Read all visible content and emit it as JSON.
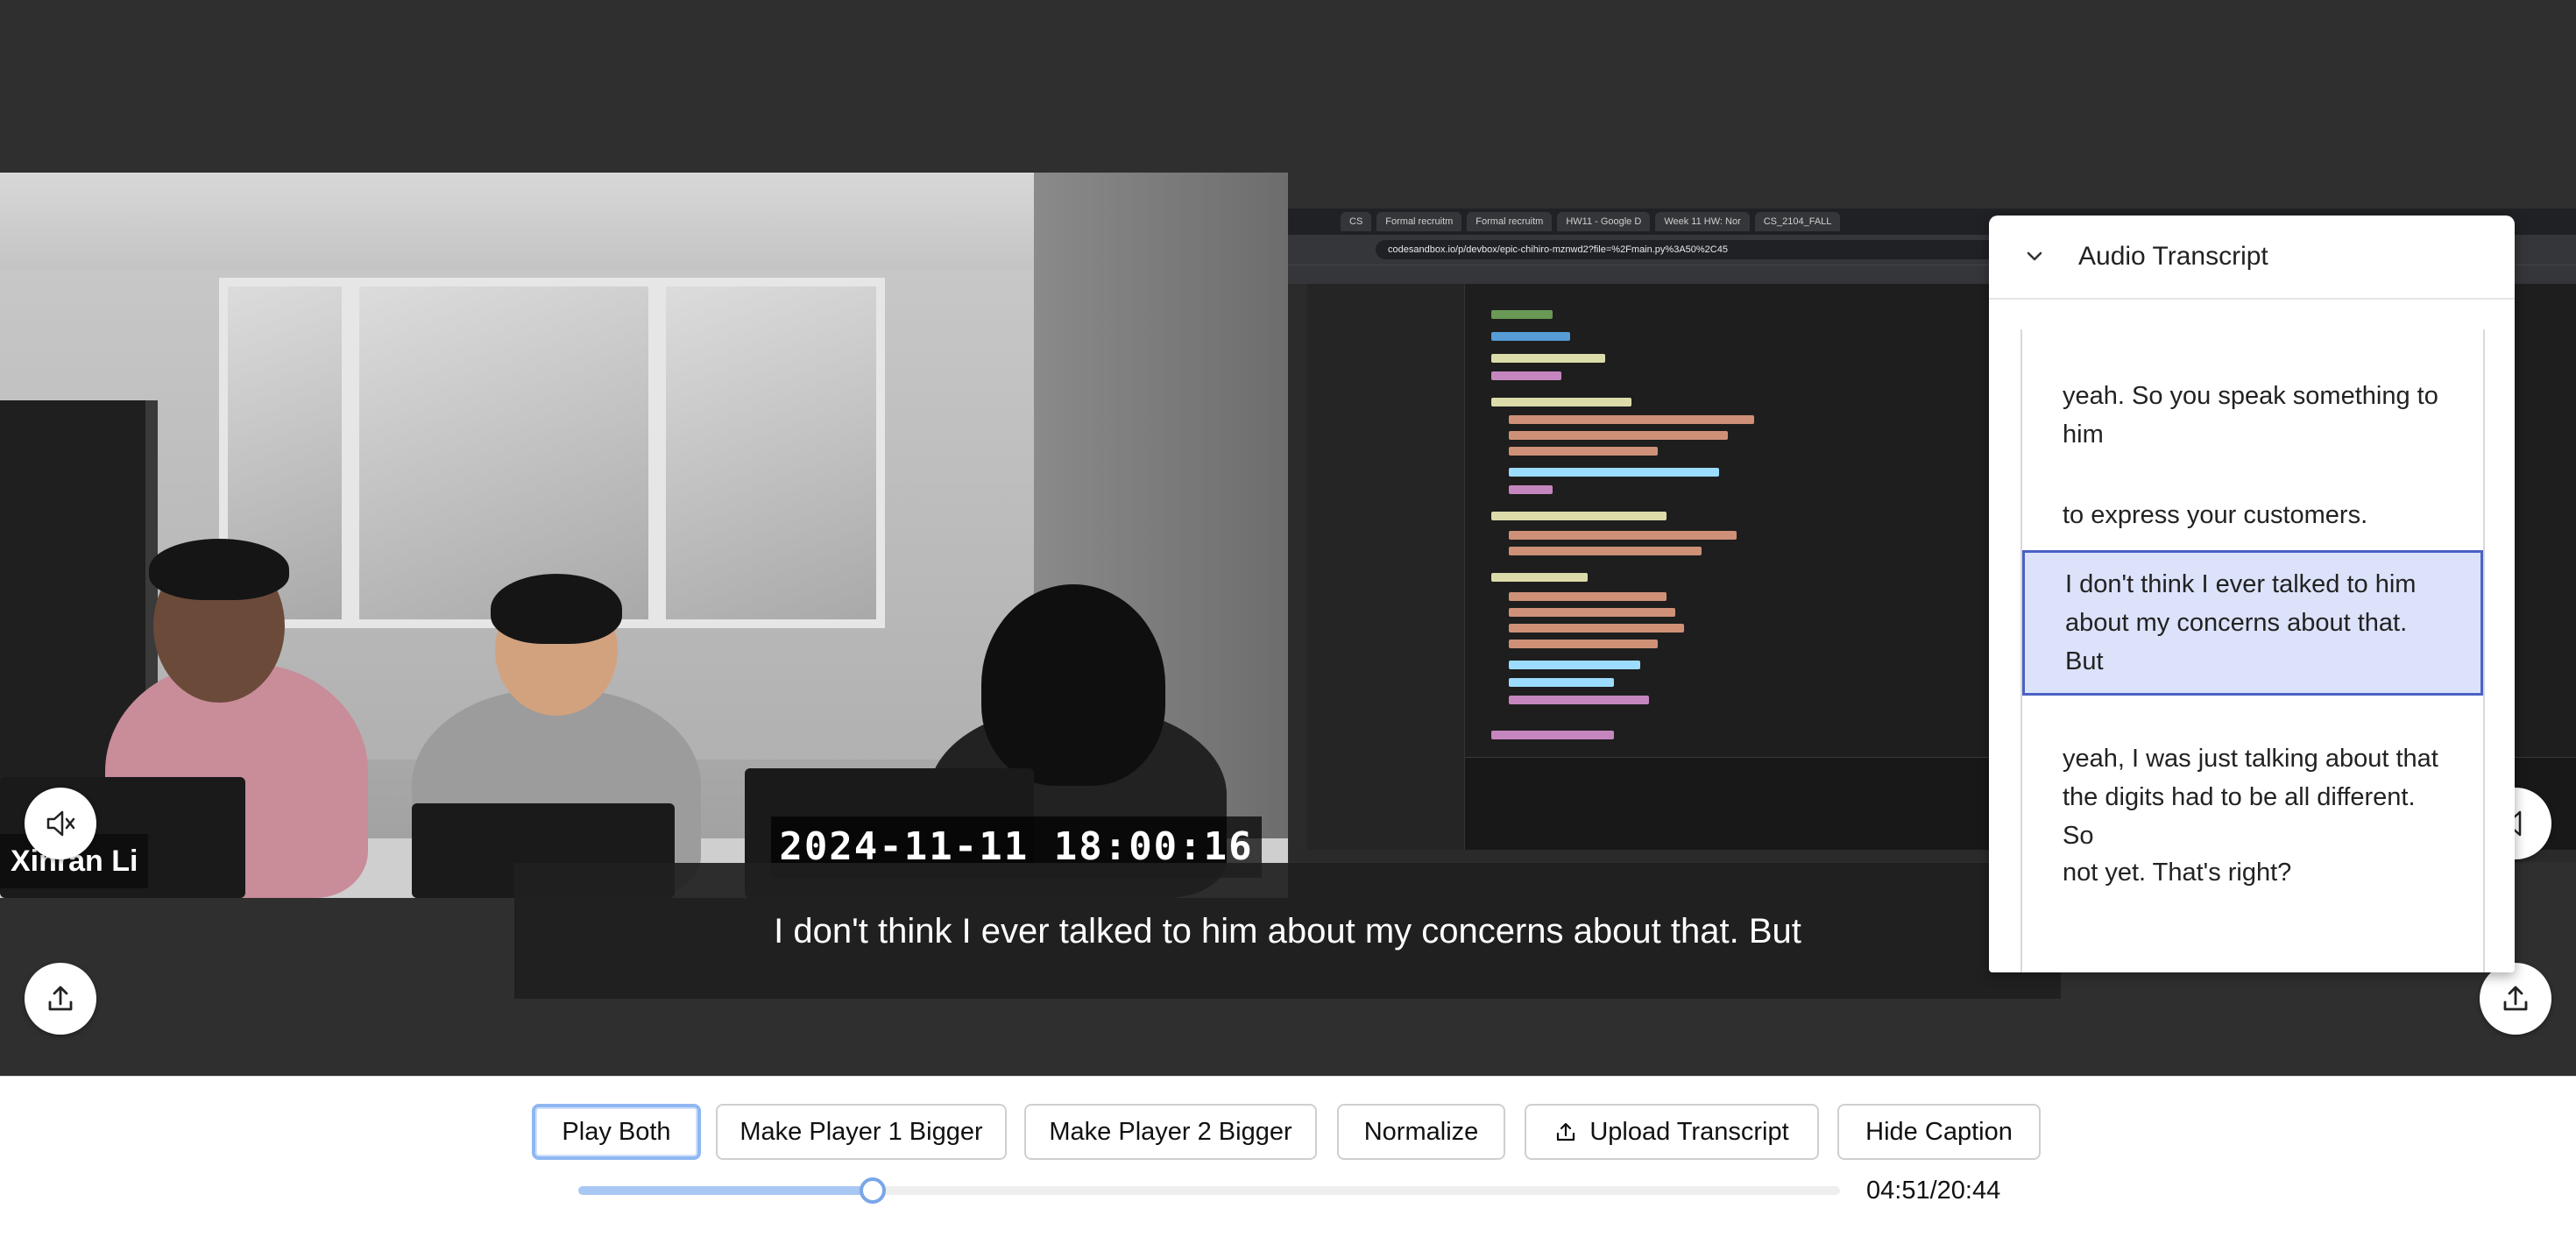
{
  "player1": {
    "speaker_name": "Xinran Li",
    "timestamp": "2024-11-11  18:00:16"
  },
  "player2": {
    "tabs": [
      "CS",
      "Formal recruitm",
      "Formal recruitm",
      "HW11 - Google D",
      "Week 11 HW: Nor",
      "CS_2104_FALL"
    ],
    "url": "codesandbox.io/p/devbox/epic-chihiro-mznwd2?file=%2Fmain.py%3A50%2C45"
  },
  "caption": {
    "text": "I don't think I ever talked to him about my concerns about that. But"
  },
  "transcript": {
    "title": "Audio Transcript",
    "items": [
      "yeah. So you speak something to him",
      "to express your customers.",
      "I don't think I ever talked to him about my concerns about that. But",
      "yeah, I was just talking about that the digits had to be all different. So",
      "not yet. That's right?"
    ],
    "active_index": 2
  },
  "controls": {
    "play_both": "Play Both",
    "make_player1_bigger": "Make Player 1 Bigger",
    "make_player2_bigger": "Make Player 2 Bigger",
    "normalize": "Normalize",
    "upload_transcript": "Upload Transcript",
    "hide_caption": "Hide Caption",
    "time": "04:51/20:44",
    "progress_fraction": 0.233
  },
  "icons": {
    "player1_mute": "speaker-muted-icon",
    "player2_volume": "speaker-icon",
    "player1_share": "share-upload-icon",
    "player2_share": "share-upload-icon",
    "transcript_toggle": "chevron-down-icon"
  },
  "colors": {
    "accent": "#7aa6e8",
    "active_item_bg": "#dbe2fa",
    "active_item_border": "#4b62c4"
  }
}
